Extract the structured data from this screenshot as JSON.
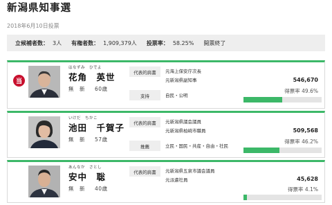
{
  "page": {
    "title": "新潟県知事選",
    "date": "2018年6月10日投票"
  },
  "summary": {
    "candidates_label": "立候補者数：",
    "candidates_value": "3人",
    "voters_label": "有権者数：",
    "voters_value": "1,909,379人",
    "turnout_label": "投票率：",
    "turnout_value": "58.25%",
    "status": "開票終了"
  },
  "candidates": [
    {
      "elected_mark": "当",
      "ruby": "はなずみ　ひでよ",
      "name": "花角　英世",
      "party": "無　新",
      "age": "60歳",
      "career_label": "代表的肩書",
      "career": [
        "元海上保安庁次長",
        "元新潟県副知事"
      ],
      "support_label": "支持",
      "support": "自民・公明",
      "votes": "546,670",
      "rate": "得票率 49.6%",
      "rate_value": 49.6
    },
    {
      "ruby": "いけだ　ちかこ",
      "name": "池田　千賀子",
      "party": "無　新",
      "age": "57歳",
      "career_label": "代表的肩書",
      "career": [
        "元新潟県議会議員",
        "元新潟県柏崎市職員"
      ],
      "support_label": "推薦",
      "support": "立民・国民・共産・自由・社民",
      "votes": "509,568",
      "rate": "得票率 46.2%",
      "rate_value": 46.2
    },
    {
      "ruby": "あんなか　さとし",
      "name": "安中　聡",
      "party": "無　新",
      "age": "40歳",
      "career_label": "代表的肩書",
      "career": [
        "元新潟県五泉市議会議員",
        "元派遣社員"
      ],
      "votes": "45,628",
      "rate": "得票率 4.1%",
      "rate_value": 4.1
    }
  ],
  "colors": {
    "accent": "#3cb868",
    "elected_badge": "#c8102e",
    "summary_bg": "#eeeeee"
  }
}
